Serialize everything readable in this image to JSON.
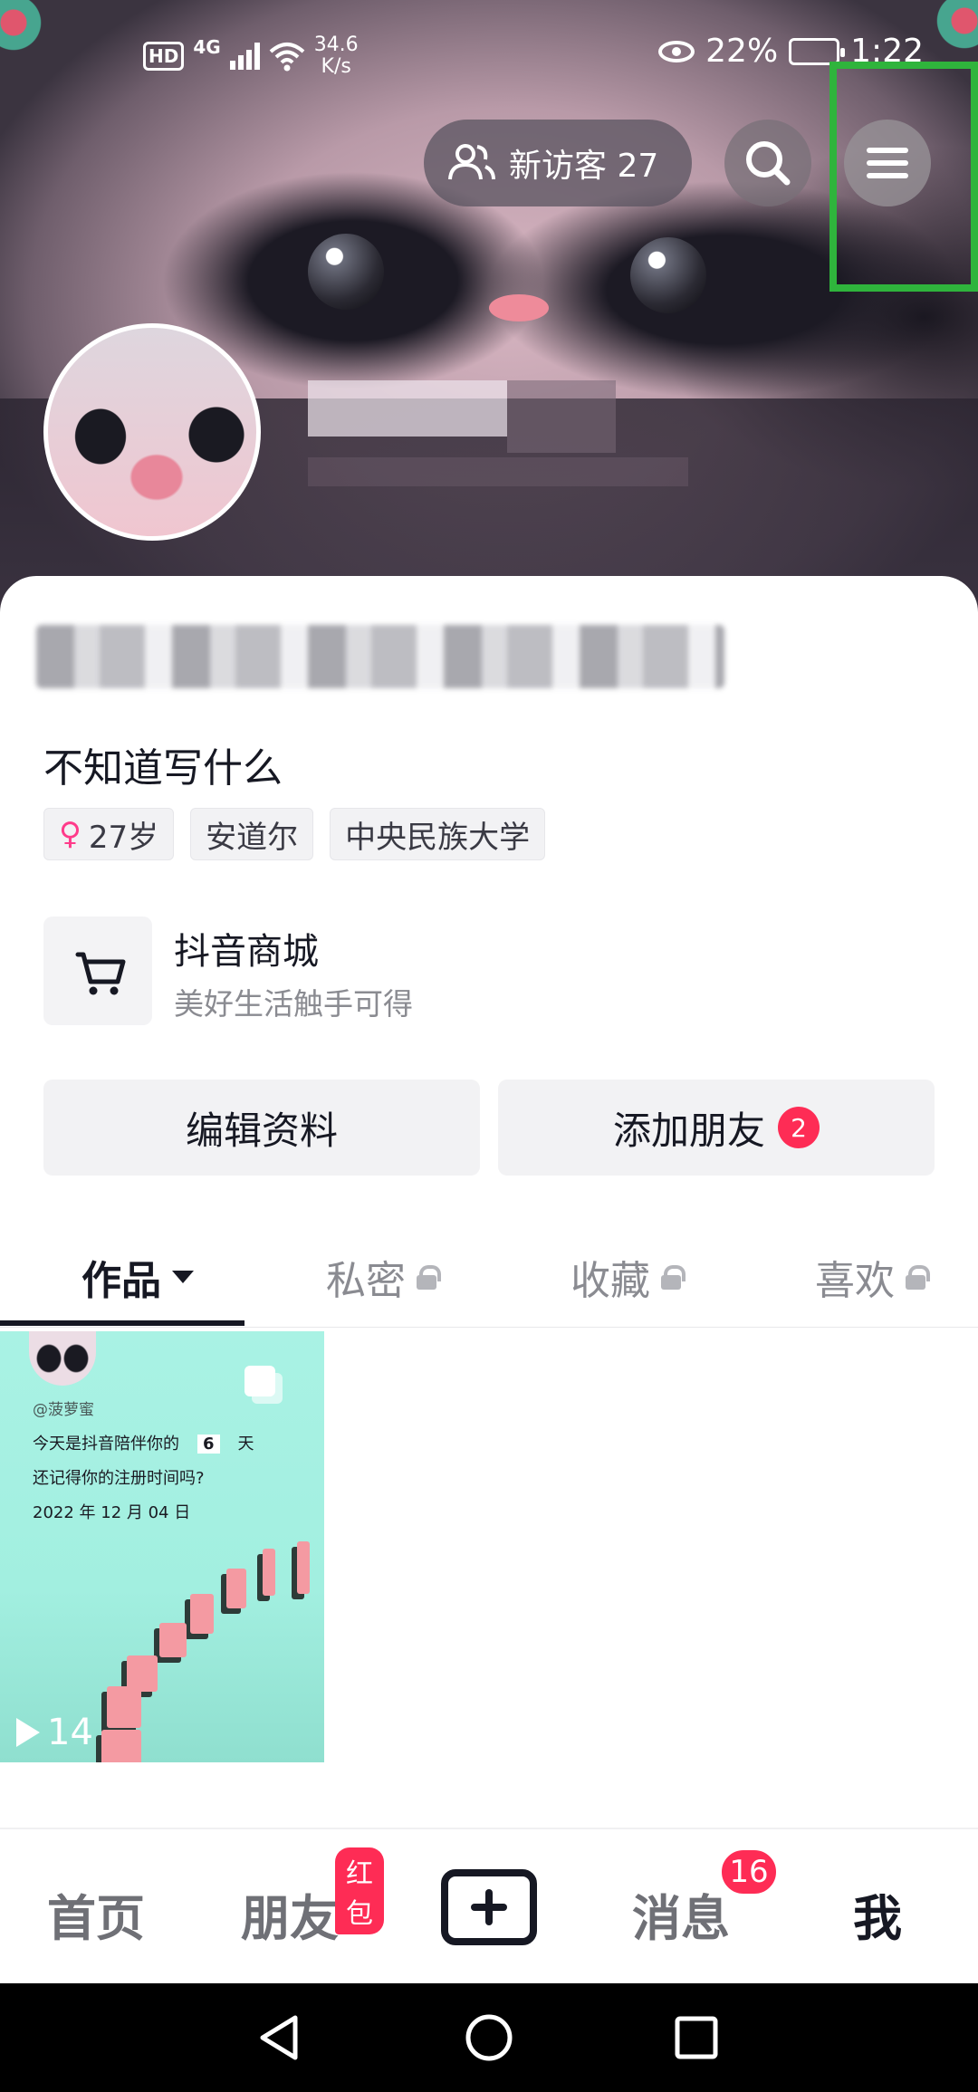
{
  "status_bar": {
    "hd": "HD",
    "network": "4G",
    "speed_value": "34.6",
    "speed_unit": "K/s",
    "battery": "22%",
    "time": "1:22"
  },
  "header": {
    "visitor_label": "新访客 27",
    "icons": [
      "visitors-icon",
      "search-icon",
      "menu-icon"
    ]
  },
  "profile": {
    "bio": "不知道写什么",
    "tags": {
      "age": "27岁",
      "location": "安道尔",
      "school": "中央民族大学"
    }
  },
  "mall": {
    "title": "抖音商城",
    "subtitle": "美好生活触手可得"
  },
  "actions": {
    "edit": "编辑资料",
    "add_friend": "添加朋友",
    "add_friend_badge": "2"
  },
  "tabs": {
    "works": "作品",
    "private": "私密",
    "favorites": "收藏",
    "likes": "喜欢"
  },
  "video": {
    "handle": "@菠萝蜜",
    "line1_pre": "今天是抖音陪伴你的",
    "line1_days": "6",
    "line1_post": "天",
    "line2": "还记得你的注册时间吗?",
    "line3": "2022 年 12 月 04 日",
    "plays": "14"
  },
  "bottom_nav": {
    "home": "首页",
    "friends": "朋友",
    "friends_badge": "红包",
    "messages": "消息",
    "messages_badge": "16",
    "me": "我"
  },
  "colors": {
    "accent_red": "#fe2c55",
    "highlight_green": "#2fb43c",
    "tile_bg": "#a9f2e4"
  }
}
